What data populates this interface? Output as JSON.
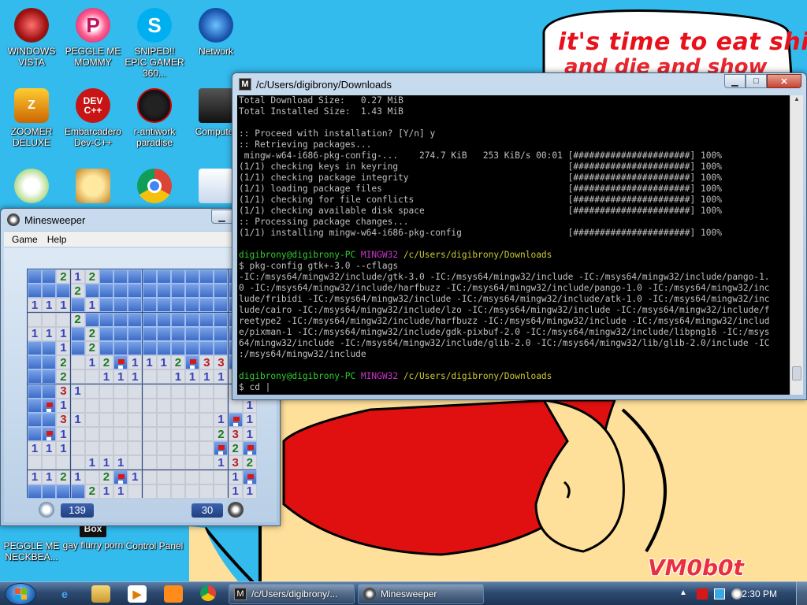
{
  "wallpaper": {
    "line1": "it's time to eat shit",
    "line2": "and die and show",
    "signature": "VM0b0t"
  },
  "desktop_icons": [
    {
      "label": "WINDOWS VISTA",
      "icon": "windows-vista-icon"
    },
    {
      "label": "PEGGLE ME MOMMY",
      "icon": "peggle-icon"
    },
    {
      "label": "SNIPED!! EPIC GAMER 360...",
      "icon": "skype-icon"
    },
    {
      "label": "Network",
      "icon": "network-icon"
    },
    {
      "label": "ZOOMER DELUXE",
      "icon": "zuma-icon"
    },
    {
      "label": "Embarcadero Dev-C++",
      "icon": "devcpp-icon"
    },
    {
      "label": "r-antiwork paradise",
      "icon": "antiwork-icon"
    },
    {
      "label": "Computer",
      "icon": "computer-icon"
    },
    {
      "label": "PEGGLE ME NECKBEA...",
      "icon": "peggle-icon"
    },
    {
      "label": "gay flurry porn",
      "icon": "box-icon"
    },
    {
      "label": "Control Panel",
      "icon": "control-panel-icon"
    }
  ],
  "devcpp_text": "DEV C++",
  "box_text": "Box",
  "minesweeper": {
    "title": "Minesweeper",
    "menu": [
      "Game",
      "Help"
    ],
    "time": "139",
    "mines": "30",
    "grid": [
      "CC212CCCCCCCCCCC",
      "CCC2CCCCCCCCCCCC",
      "111C1CCCCCCCCCCC",
      "ooo2CCCCCCCCCCCC",
      "111C2CCCCCCCCCCC",
      "CC1C2CCCCCCCCCCC",
      "CC2o12F1112F33CC",
      "CC2oo111oo111111",
      "CC31oooooooooooo",
      "CF1oooooooooooo1",
      "CC31ooooooooo1F1",
      "CF1oooooooooo231",
      "111ooooooooooF2F",
      "oooo111oooooo132",
      "1121o2F1oooooo1F",
      "CCCC211ooooooo11"
    ]
  },
  "terminal": {
    "title": "/c/Users/digibrony/Downloads",
    "lines": [
      {
        "t": "Total Download Size:   0.27 MiB",
        "c": ""
      },
      {
        "t": "Total Installed Size:  1.43 MiB",
        "c": ""
      },
      {
        "t": "",
        "c": ""
      },
      {
        "t": ":: Proceed with installation? [Y/n] y",
        "c": ""
      },
      {
        "t": ":: Retrieving packages...",
        "c": ""
      },
      {
        "t": " mingw-w64-i686-pkg-config-...    274.7 KiB   253 KiB/s 00:01 [######################] 100%",
        "c": ""
      },
      {
        "t": "(1/1) checking keys in keyring                                [######################] 100%",
        "c": ""
      },
      {
        "t": "(1/1) checking package integrity                              [######################] 100%",
        "c": ""
      },
      {
        "t": "(1/1) loading package files                                   [######################] 100%",
        "c": ""
      },
      {
        "t": "(1/1) checking for file conflicts                             [######################] 100%",
        "c": ""
      },
      {
        "t": "(1/1) checking available disk space                           [######################] 100%",
        "c": ""
      },
      {
        "t": ":: Processing package changes...",
        "c": ""
      },
      {
        "t": "(1/1) installing mingw-w64-i686-pkg-config                    [######################] 100%",
        "c": ""
      },
      {
        "t": "",
        "c": ""
      },
      {
        "t": "digibrony@digibrony-PC MINGW32 /c/Users/digibrony/Downloads",
        "c": "prompt"
      },
      {
        "t": "$ pkg-config gtk+-3.0 --cflags",
        "c": ""
      },
      {
        "t": "-IC:/msys64/mingw32/include/gtk-3.0 -IC:/msys64/mingw32/include -IC:/msys64/mingw32/include/pango-1.",
        "c": ""
      },
      {
        "t": "0 -IC:/msys64/mingw32/include/harfbuzz -IC:/msys64/mingw32/include/pango-1.0 -IC:/msys64/mingw32/inc",
        "c": ""
      },
      {
        "t": "lude/fribidi -IC:/msys64/mingw32/include -IC:/msys64/mingw32/include/atk-1.0 -IC:/msys64/mingw32/inc",
        "c": ""
      },
      {
        "t": "lude/cairo -IC:/msys64/mingw32/include/lzo -IC:/msys64/mingw32/include -IC:/msys64/mingw32/include/f",
        "c": ""
      },
      {
        "t": "reetype2 -IC:/msys64/mingw32/include/harfbuzz -IC:/msys64/mingw32/include -IC:/msys64/mingw32/includ",
        "c": ""
      },
      {
        "t": "e/pixman-1 -IC:/msys64/mingw32/include/gdk-pixbuf-2.0 -IC:/msys64/mingw32/include/libpng16 -IC:/msys",
        "c": ""
      },
      {
        "t": "64/mingw32/include -IC:/msys64/mingw32/include/glib-2.0 -IC:/msys64/mingw32/lib/glib-2.0/include -IC",
        "c": ""
      },
      {
        "t": ":/msys64/mingw32/include",
        "c": ""
      },
      {
        "t": "",
        "c": ""
      },
      {
        "t": "digibrony@digibrony-PC MINGW32 /c/Users/digibrony/Downloads",
        "c": "prompt"
      },
      {
        "t": "$ cd |",
        "c": ""
      }
    ]
  },
  "taskbar": {
    "tasks": [
      {
        "label": "/c/Users/digibrony/...",
        "icon": "msys-icon"
      },
      {
        "label": "Minesweeper",
        "icon": "minesweeper-icon"
      }
    ],
    "clock": "2:30 PM"
  }
}
